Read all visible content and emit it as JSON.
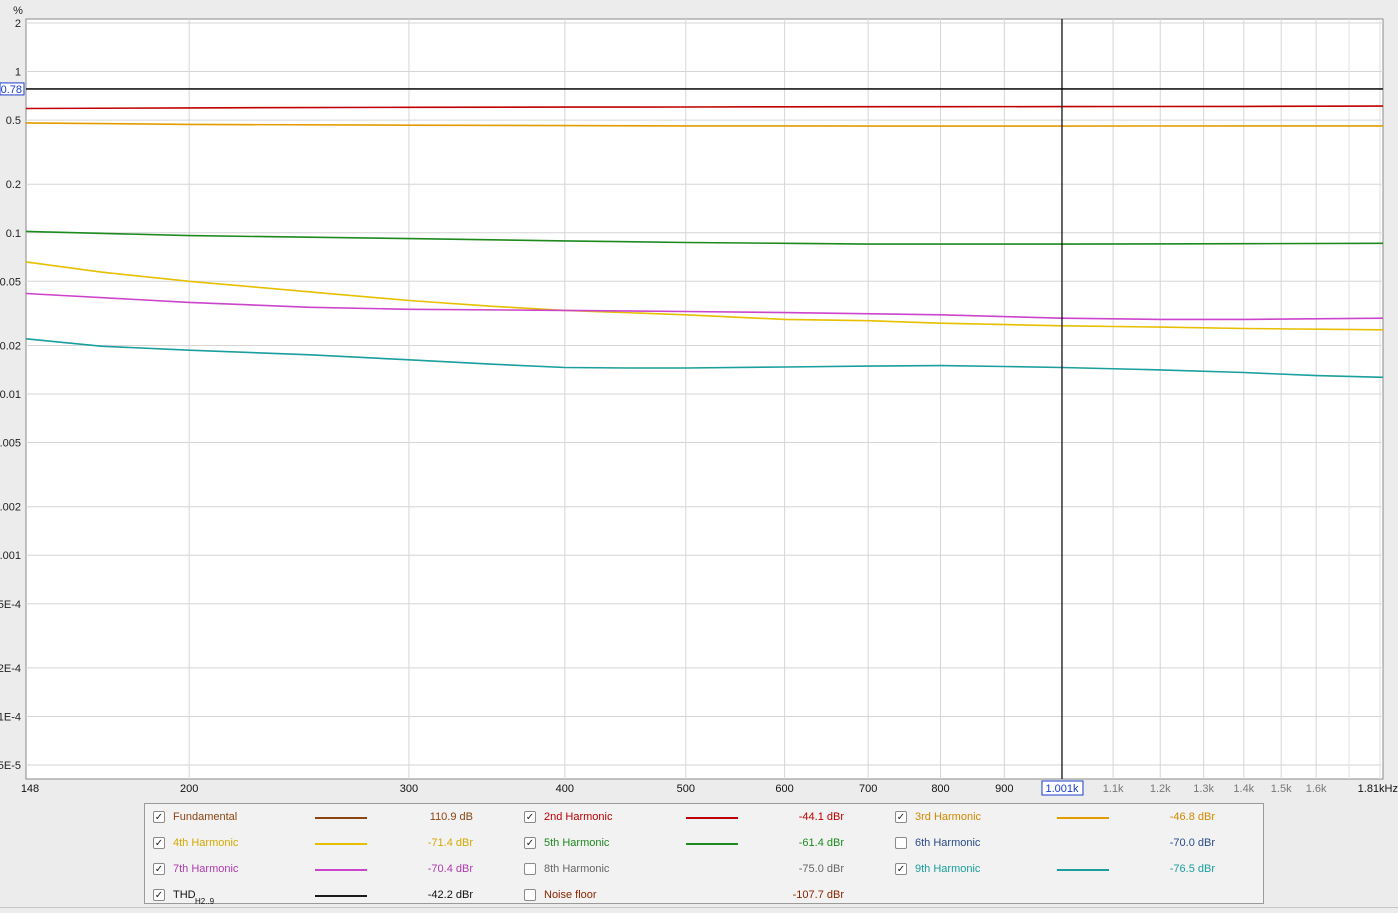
{
  "chart_data": {
    "type": "line",
    "y_unit": "%",
    "x_unit": "kHz",
    "x_scale": "log",
    "y_scale": "log",
    "xlim": [
      148,
      1810
    ],
    "ylim": [
      4e-05,
      2
    ],
    "grid": true,
    "cursor": {
      "x": 1001,
      "x_label": "1.001k",
      "y": 0.78,
      "y_label": "0.78"
    },
    "y_ticks": [
      {
        "v": 2,
        "label": "2"
      },
      {
        "v": 1,
        "label": "1"
      },
      {
        "v": 0.5,
        "label": "0.5"
      },
      {
        "v": 0.2,
        "label": "0.2"
      },
      {
        "v": 0.1,
        "label": "0.1"
      },
      {
        "v": 0.05,
        "label": "0.05"
      },
      {
        "v": 0.02,
        "label": "0.02"
      },
      {
        "v": 0.01,
        "label": "0.01"
      },
      {
        "v": 0.005,
        "label": "0.005"
      },
      {
        "v": 0.002,
        "label": "0.002"
      },
      {
        "v": 0.001,
        "label": "0.001"
      },
      {
        "v": 0.0005,
        "label": "5E-4"
      },
      {
        "v": 0.0002,
        "label": "2E-4"
      },
      {
        "v": 0.0001,
        "label": "1E-4"
      },
      {
        "v": 5e-05,
        "label": "5E-5"
      }
    ],
    "x_ticks": [
      {
        "v": 148,
        "label": "148",
        "major": true
      },
      {
        "v": 200,
        "label": "200",
        "major": true
      },
      {
        "v": 300,
        "label": "300",
        "major": true
      },
      {
        "v": 400,
        "label": "400",
        "major": true
      },
      {
        "v": 500,
        "label": "500",
        "major": true
      },
      {
        "v": 600,
        "label": "600",
        "major": true
      },
      {
        "v": 700,
        "label": "700",
        "major": true
      },
      {
        "v": 800,
        "label": "800",
        "major": true
      },
      {
        "v": 900,
        "label": "900",
        "major": true
      },
      {
        "v": 1100,
        "label": "1.1k",
        "major": false
      },
      {
        "v": 1200,
        "label": "1.2k",
        "major": false
      },
      {
        "v": 1300,
        "label": "1.3k",
        "major": false
      },
      {
        "v": 1400,
        "label": "1.4k",
        "major": false
      },
      {
        "v": 1500,
        "label": "1.5k",
        "major": false
      },
      {
        "v": 1600,
        "label": "1.6k",
        "major": false
      },
      {
        "v": 1810,
        "label": "1.81kHz",
        "major": true
      }
    ],
    "series": [
      {
        "name": "THD",
        "color": "#1a1a1a",
        "x": [
          148,
          1810
        ],
        "y": [
          0.78,
          0.78
        ]
      },
      {
        "name": "2nd Harmonic",
        "color": "#c00000",
        "x": [
          148,
          200,
          300,
          400,
          500,
          600,
          800,
          1001,
          1400,
          1810
        ],
        "y": [
          0.59,
          0.595,
          0.6,
          0.602,
          0.603,
          0.604,
          0.605,
          0.606,
          0.608,
          0.61
        ]
      },
      {
        "name": "3rd Harmonic",
        "color": "#e39b00",
        "x": [
          148,
          200,
          300,
          400,
          500,
          600,
          800,
          1001,
          1400,
          1810
        ],
        "y": [
          0.48,
          0.47,
          0.465,
          0.462,
          0.46,
          0.46,
          0.459,
          0.459,
          0.46,
          0.46
        ]
      },
      {
        "name": "5th Harmonic",
        "color": "#1e8a1e",
        "x": [
          148,
          200,
          300,
          400,
          500,
          600,
          700,
          800,
          1001,
          1400,
          1810
        ],
        "y": [
          0.102,
          0.096,
          0.092,
          0.089,
          0.087,
          0.086,
          0.085,
          0.085,
          0.085,
          0.0855,
          0.086
        ]
      },
      {
        "name": "4th Harmonic",
        "color": "#e6bf00",
        "x": [
          148,
          170,
          200,
          250,
          300,
          350,
          400,
          500,
          600,
          700,
          800,
          1001,
          1200,
          1400,
          1810
        ],
        "y": [
          0.066,
          0.057,
          0.05,
          0.043,
          0.038,
          0.035,
          0.033,
          0.031,
          0.029,
          0.0285,
          0.0275,
          0.0265,
          0.026,
          0.0255,
          0.025
        ]
      },
      {
        "name": "7th Harmonic",
        "color": "#cc44cc",
        "x": [
          148,
          200,
          250,
          300,
          400,
          500,
          600,
          800,
          1001,
          1200,
          1400,
          1810
        ],
        "y": [
          0.042,
          0.037,
          0.0345,
          0.0335,
          0.033,
          0.0325,
          0.032,
          0.031,
          0.0295,
          0.029,
          0.029,
          0.0295
        ]
      },
      {
        "name": "9th Harmonic",
        "color": "#1a9e9e",
        "x": [
          148,
          170,
          200,
          250,
          300,
          350,
          400,
          450,
          500,
          600,
          700,
          800,
          900,
          1001,
          1200,
          1400,
          1600,
          1810
        ],
        "y": [
          0.022,
          0.0198,
          0.0187,
          0.0175,
          0.0163,
          0.0153,
          0.0146,
          0.0145,
          0.0145,
          0.0147,
          0.0149,
          0.015,
          0.0148,
          0.0146,
          0.0141,
          0.0136,
          0.013,
          0.0127
        ]
      }
    ]
  },
  "legend": {
    "rows": [
      [
        {
          "label": "Fundamental",
          "value": "110.9 dB",
          "checked": true,
          "color": "#8b4513",
          "show_swatch": true,
          "label_color": "#8b4513"
        },
        {
          "label": "2nd Harmonic",
          "value": "-44.1 dBr",
          "checked": true,
          "color": "#c00000",
          "show_swatch": true,
          "label_color": "#c00000"
        },
        {
          "label": "3rd Harmonic",
          "value": "-46.8 dBr",
          "checked": true,
          "color": "#e39b00",
          "show_swatch": true,
          "label_color": "#d08a00"
        }
      ],
      [
        {
          "label": "4th Harmonic",
          "value": "-71.4 dBr",
          "checked": true,
          "color": "#e6bf00",
          "show_swatch": true,
          "label_color": "#d4a800"
        },
        {
          "label": "5th Harmonic",
          "value": "-61.4 dBr",
          "checked": true,
          "color": "#1e8a1e",
          "show_swatch": true,
          "label_color": "#1e8a1e"
        },
        {
          "label": "6th Harmonic",
          "value": "-70.0 dBr",
          "checked": false,
          "color": "#2a4a8a",
          "show_swatch": false,
          "label_color": "#2a4a8a"
        }
      ],
      [
        {
          "label": "7th Harmonic",
          "value": "-70.4 dBr",
          "checked": true,
          "color": "#cc44cc",
          "show_swatch": true,
          "label_color": "#b03ab0"
        },
        {
          "label": "8th Harmonic",
          "value": "-75.0 dBr",
          "checked": false,
          "color": "#666666",
          "show_swatch": false,
          "label_color": "#666666"
        },
        {
          "label": "9th Harmonic",
          "value": "-76.5 dBr",
          "checked": true,
          "color": "#1a9e9e",
          "show_swatch": true,
          "label_color": "#1a9e9e"
        }
      ],
      [
        {
          "label": "THD",
          "sub": "H2..9",
          "value": "-42.2 dBr",
          "checked": true,
          "color": "#1a1a1a",
          "show_swatch": true,
          "label_color": "#111111"
        },
        {
          "label": "Noise floor",
          "value": "-107.7 dBr",
          "checked": false,
          "color": "#8b2500",
          "show_swatch": false,
          "label_color": "#8b2500"
        }
      ]
    ]
  }
}
